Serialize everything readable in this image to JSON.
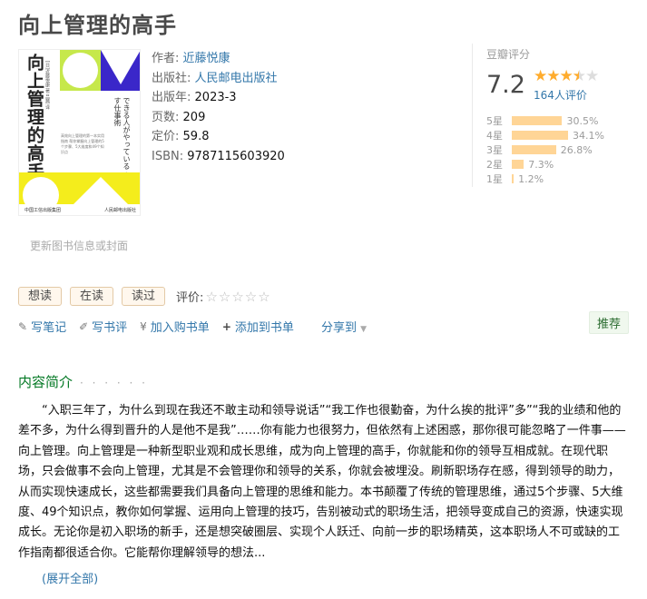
{
  "book": {
    "title": "向上管理的高手",
    "author_label": "作者:",
    "author": "近藤悦康",
    "publisher_label": "出版社:",
    "publisher": "人民邮电出版社",
    "year_label": "出版年:",
    "year": "2023-3",
    "pages_label": "页数:",
    "pages": "209",
    "price_label": "定价:",
    "price": "59.8",
    "isbn_label": "ISBN:",
    "isbn": "9787115603920"
  },
  "cover": {
    "vertical_title": "向上管理的高手",
    "author_line": "[日]近藤悦康 著 吕茜 译",
    "japanese_title": "できる人がやっている 上司を動かす仕事術",
    "small_text": "高效向上管理的第一本实用指南 帮你掌握向上管理的5个步骤、5大维度和49个知识点",
    "publisher_left": "中国工信出版集团",
    "publisher_right": "人民邮电出版社",
    "colors": {
      "green": "#c6e84b",
      "blue": "#3a27c9",
      "yellow": "#f4ed1c"
    }
  },
  "update_link": "更新图书信息或封面",
  "rating": {
    "header": "豆瓣评分",
    "score": "7.2",
    "stars_filled": 3.5,
    "stars_icon": "star-rating-icon",
    "count": "164人评价",
    "distribution": [
      {
        "label": "5星",
        "percent": "30.5%",
        "value": 30.5
      },
      {
        "label": "4星",
        "percent": "34.1%",
        "value": 34.1
      },
      {
        "label": "3星",
        "percent": "26.8%",
        "value": 26.8
      },
      {
        "label": "2星",
        "percent": "7.3%",
        "value": 7.3
      },
      {
        "label": "1星",
        "percent": "1.2%",
        "value": 1.2
      }
    ]
  },
  "status_buttons": {
    "want": "想读",
    "reading": "在读",
    "read": "读过",
    "rate_label": "评价:",
    "empty_stars": "☆☆☆☆☆"
  },
  "actions": {
    "write_note": "写笔记",
    "write_review": "写书评",
    "add_cart": "加入购书单",
    "add_booklist": "添加到书单",
    "share": "分享到",
    "recommend": "推荐"
  },
  "intro": {
    "heading": "内容简介",
    "dots": "· · · · · ·",
    "text": "“入职三年了，为什么到现在我还不敢主动和领导说话”“我工作也很勤奋，为什么挨的批评”多”“我的业绩和他的差不多，为什么得到晋升的人是他不是我”……你有能力也很努力，但依然有上述困惑，那你很可能忽略了一件事——向上管理。向上管理是一种新型职业观和成长思维，成为向上管理的高手，你就能和你的领导互相成就。在现代职场，只会做事不会向上管理，尤其是不会管理你和领导的关系，你就会被埋没。刷新职场存在感，得到领导的助力，从而实现快速成长，这些都需要我们具备向上管理的思维和能力。本书颠覆了传统的管理思维，通过5个步骤、5大维度、49个知识点，教你如何掌握、运用向上管理的技巧，告别被动式的职场生活，把领导变成自己的资源，快速实现成长。无论你是初入职场的新手，还是想突破圈层、实现个人跃迁、向前一步的职场精英，这本职场人不可或缺的工作指南都很适合你。它能帮你理解领导的想法...",
    "expand": "(展开全部)"
  }
}
